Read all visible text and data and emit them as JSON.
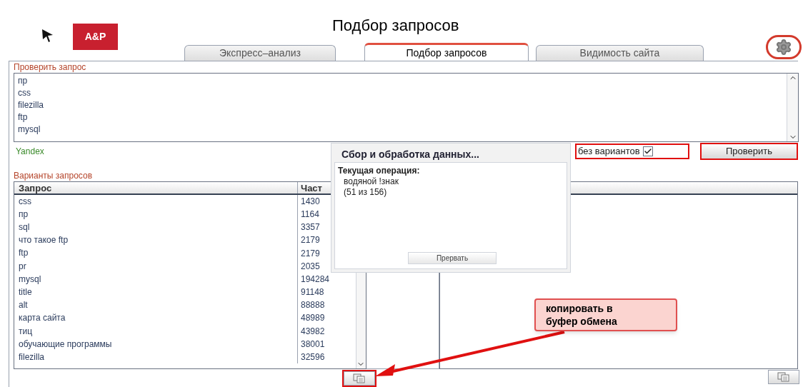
{
  "header": {
    "logo": "A&P",
    "title": "Подбор запросов"
  },
  "tabs": [
    {
      "label": "Экспресс–анализ",
      "selected": false
    },
    {
      "label": "Подбор запросов",
      "selected": true
    },
    {
      "label": "Видимость сайта",
      "selected": false
    }
  ],
  "check_section": {
    "label": "Проверить запрос",
    "queries": [
      "пр",
      "css",
      "filezilla",
      "ftp",
      "mysql"
    ],
    "engine": "Yandex",
    "no_variants": {
      "label": "без вариантов",
      "checked": true
    },
    "button": "Проверить"
  },
  "variants": {
    "label": "Варианты запросов",
    "columns": [
      "Запрос",
      "Част"
    ],
    "rows": [
      [
        "css",
        "1430"
      ],
      [
        "пр",
        "1164"
      ],
      [
        "sql",
        "3357"
      ],
      [
        "что такое ftp",
        "2179"
      ],
      [
        "ftp",
        "2179"
      ],
      [
        "pr",
        "2035"
      ],
      [
        "mysql",
        "194284"
      ],
      [
        "title",
        "91148"
      ],
      [
        "alt",
        "88888"
      ],
      [
        "карта сайта",
        "48989"
      ],
      [
        "тиц",
        "43982"
      ],
      [
        "обучающие программы",
        "38001"
      ],
      [
        "filezilla",
        "32596"
      ]
    ]
  },
  "progress_dialog": {
    "title": "Сбор и обработка данных...",
    "operation_label": "Текущая операция:",
    "operation": "водяной !знак",
    "counter": "(51 из 156)",
    "button": "Прервать"
  },
  "callout": {
    "lines": [
      "копировать в",
      "буфер обмена"
    ]
  }
}
